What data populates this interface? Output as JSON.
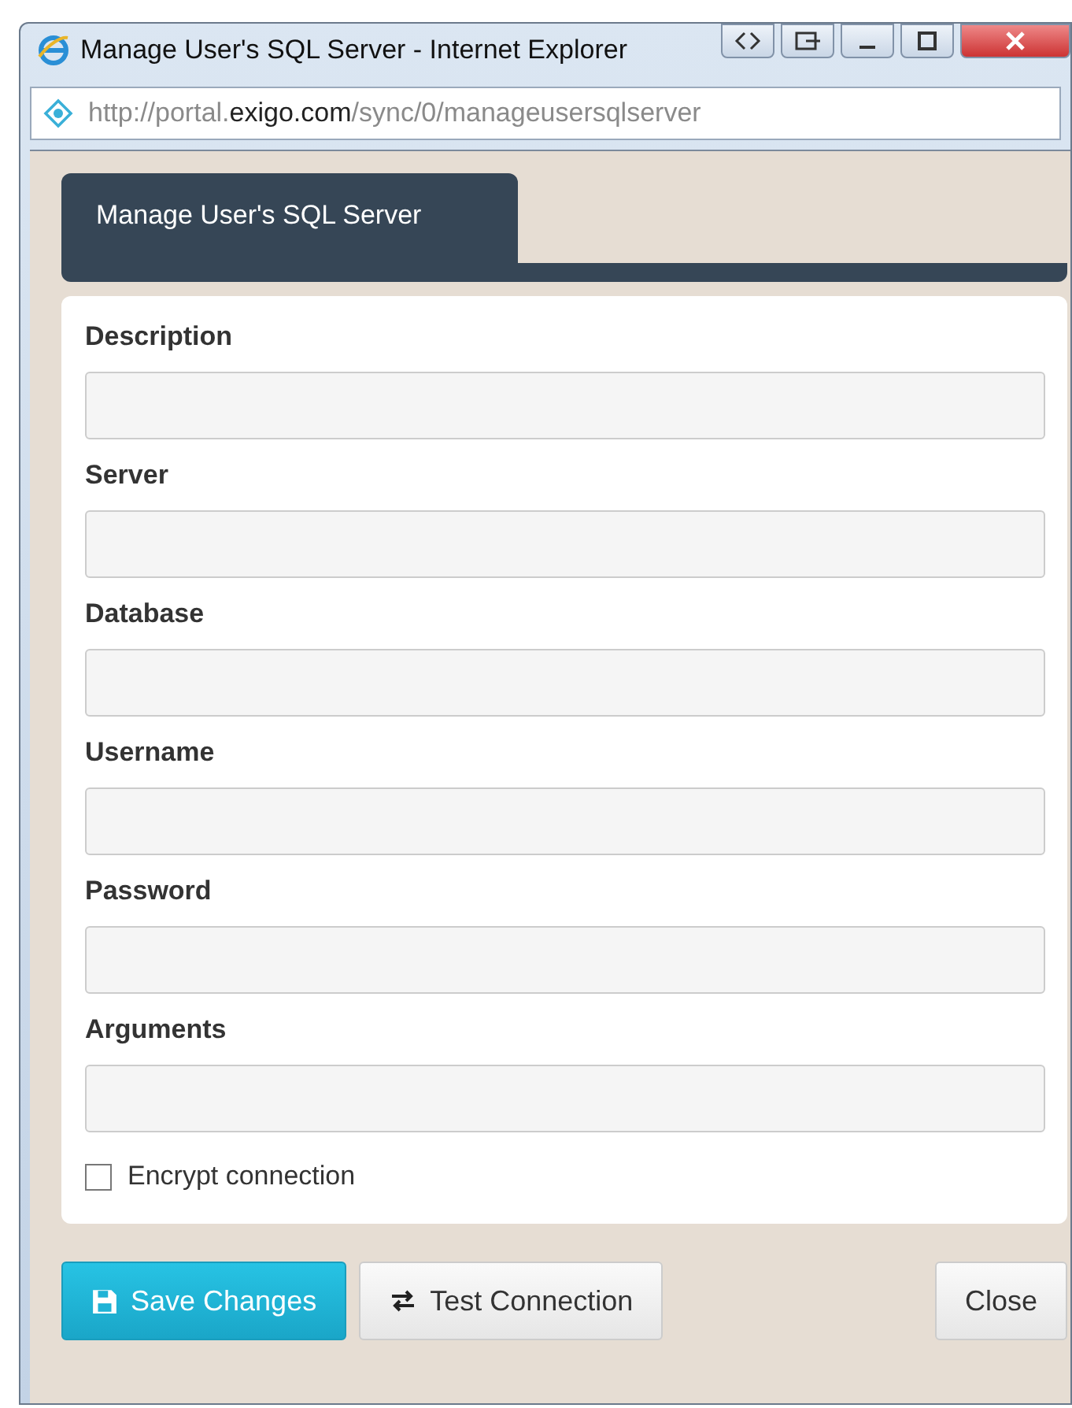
{
  "window": {
    "title": "Manage User's SQL Server - Internet Explorer",
    "url": "http://portal.**exigo.com**/sync/0/manageusersqlserver"
  },
  "tabs": [
    {
      "label": "Manage User's SQL Server",
      "selected": true
    }
  ],
  "fields": [
    {
      "label": "Description"
    },
    {
      "label": "Server"
    },
    {
      "label": "Database"
    },
    {
      "label": "Username"
    },
    {
      "label": "Password"
    },
    {
      "label": "Arguments"
    }
  ],
  "encrypt": {
    "label": "Encrypt connection",
    "checked": false
  },
  "buttons": [
    {
      "label": "Save Changes",
      "kind": "primary"
    },
    {
      "label": "Test Connection",
      "kind": "test"
    },
    {
      "label": "Close",
      "kind": "close"
    }
  ]
}
